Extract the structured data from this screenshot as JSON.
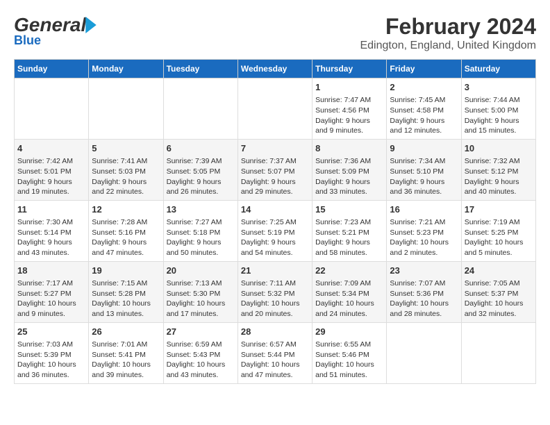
{
  "header": {
    "logo_general": "General",
    "logo_blue": "Blue",
    "title": "February 2024",
    "subtitle": "Edington, England, United Kingdom"
  },
  "calendar": {
    "weekdays": [
      "Sunday",
      "Monday",
      "Tuesday",
      "Wednesday",
      "Thursday",
      "Friday",
      "Saturday"
    ],
    "weeks": [
      [
        {
          "day": "",
          "info": ""
        },
        {
          "day": "",
          "info": ""
        },
        {
          "day": "",
          "info": ""
        },
        {
          "day": "",
          "info": ""
        },
        {
          "day": "1",
          "info": "Sunrise: 7:47 AM\nSunset: 4:56 PM\nDaylight: 9 hours\nand 9 minutes."
        },
        {
          "day": "2",
          "info": "Sunrise: 7:45 AM\nSunset: 4:58 PM\nDaylight: 9 hours\nand 12 minutes."
        },
        {
          "day": "3",
          "info": "Sunrise: 7:44 AM\nSunset: 5:00 PM\nDaylight: 9 hours\nand 15 minutes."
        }
      ],
      [
        {
          "day": "4",
          "info": "Sunrise: 7:42 AM\nSunset: 5:01 PM\nDaylight: 9 hours\nand 19 minutes."
        },
        {
          "day": "5",
          "info": "Sunrise: 7:41 AM\nSunset: 5:03 PM\nDaylight: 9 hours\nand 22 minutes."
        },
        {
          "day": "6",
          "info": "Sunrise: 7:39 AM\nSunset: 5:05 PM\nDaylight: 9 hours\nand 26 minutes."
        },
        {
          "day": "7",
          "info": "Sunrise: 7:37 AM\nSunset: 5:07 PM\nDaylight: 9 hours\nand 29 minutes."
        },
        {
          "day": "8",
          "info": "Sunrise: 7:36 AM\nSunset: 5:09 PM\nDaylight: 9 hours\nand 33 minutes."
        },
        {
          "day": "9",
          "info": "Sunrise: 7:34 AM\nSunset: 5:10 PM\nDaylight: 9 hours\nand 36 minutes."
        },
        {
          "day": "10",
          "info": "Sunrise: 7:32 AM\nSunset: 5:12 PM\nDaylight: 9 hours\nand 40 minutes."
        }
      ],
      [
        {
          "day": "11",
          "info": "Sunrise: 7:30 AM\nSunset: 5:14 PM\nDaylight: 9 hours\nand 43 minutes."
        },
        {
          "day": "12",
          "info": "Sunrise: 7:28 AM\nSunset: 5:16 PM\nDaylight: 9 hours\nand 47 minutes."
        },
        {
          "day": "13",
          "info": "Sunrise: 7:27 AM\nSunset: 5:18 PM\nDaylight: 9 hours\nand 50 minutes."
        },
        {
          "day": "14",
          "info": "Sunrise: 7:25 AM\nSunset: 5:19 PM\nDaylight: 9 hours\nand 54 minutes."
        },
        {
          "day": "15",
          "info": "Sunrise: 7:23 AM\nSunset: 5:21 PM\nDaylight: 9 hours\nand 58 minutes."
        },
        {
          "day": "16",
          "info": "Sunrise: 7:21 AM\nSunset: 5:23 PM\nDaylight: 10 hours\nand 2 minutes."
        },
        {
          "day": "17",
          "info": "Sunrise: 7:19 AM\nSunset: 5:25 PM\nDaylight: 10 hours\nand 5 minutes."
        }
      ],
      [
        {
          "day": "18",
          "info": "Sunrise: 7:17 AM\nSunset: 5:27 PM\nDaylight: 10 hours\nand 9 minutes."
        },
        {
          "day": "19",
          "info": "Sunrise: 7:15 AM\nSunset: 5:28 PM\nDaylight: 10 hours\nand 13 minutes."
        },
        {
          "day": "20",
          "info": "Sunrise: 7:13 AM\nSunset: 5:30 PM\nDaylight: 10 hours\nand 17 minutes."
        },
        {
          "day": "21",
          "info": "Sunrise: 7:11 AM\nSunset: 5:32 PM\nDaylight: 10 hours\nand 20 minutes."
        },
        {
          "day": "22",
          "info": "Sunrise: 7:09 AM\nSunset: 5:34 PM\nDaylight: 10 hours\nand 24 minutes."
        },
        {
          "day": "23",
          "info": "Sunrise: 7:07 AM\nSunset: 5:36 PM\nDaylight: 10 hours\nand 28 minutes."
        },
        {
          "day": "24",
          "info": "Sunrise: 7:05 AM\nSunset: 5:37 PM\nDaylight: 10 hours\nand 32 minutes."
        }
      ],
      [
        {
          "day": "25",
          "info": "Sunrise: 7:03 AM\nSunset: 5:39 PM\nDaylight: 10 hours\nand 36 minutes."
        },
        {
          "day": "26",
          "info": "Sunrise: 7:01 AM\nSunset: 5:41 PM\nDaylight: 10 hours\nand 39 minutes."
        },
        {
          "day": "27",
          "info": "Sunrise: 6:59 AM\nSunset: 5:43 PM\nDaylight: 10 hours\nand 43 minutes."
        },
        {
          "day": "28",
          "info": "Sunrise: 6:57 AM\nSunset: 5:44 PM\nDaylight: 10 hours\nand 47 minutes."
        },
        {
          "day": "29",
          "info": "Sunrise: 6:55 AM\nSunset: 5:46 PM\nDaylight: 10 hours\nand 51 minutes."
        },
        {
          "day": "",
          "info": ""
        },
        {
          "day": "",
          "info": ""
        }
      ]
    ]
  }
}
